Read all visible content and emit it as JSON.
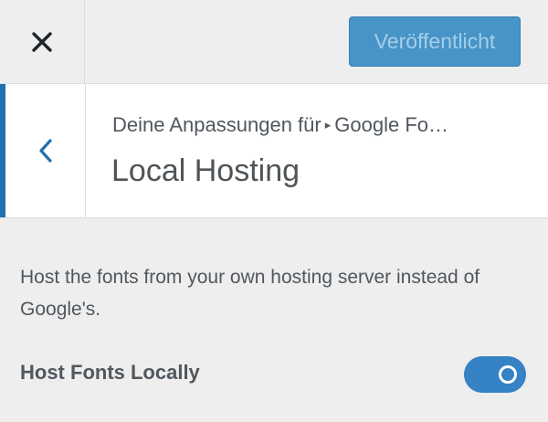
{
  "header": {
    "close_icon": "close-icon",
    "publish_label": "Veröffentlicht"
  },
  "section": {
    "back_icon": "chevron-left-icon",
    "breadcrumb_parent": "Deine Anpassungen für",
    "breadcrumb_separator": "▸",
    "breadcrumb_current": "Google Fo…",
    "title": "Local Hosting"
  },
  "content": {
    "description": "Host the fonts from your own hosting server instead of Google's.",
    "toggle_label": "Host Fonts Locally",
    "toggle_state": "on"
  },
  "colors": {
    "accent": "#2271b1",
    "publish_button": "#4694c8",
    "toggle_on": "#3582c4"
  }
}
